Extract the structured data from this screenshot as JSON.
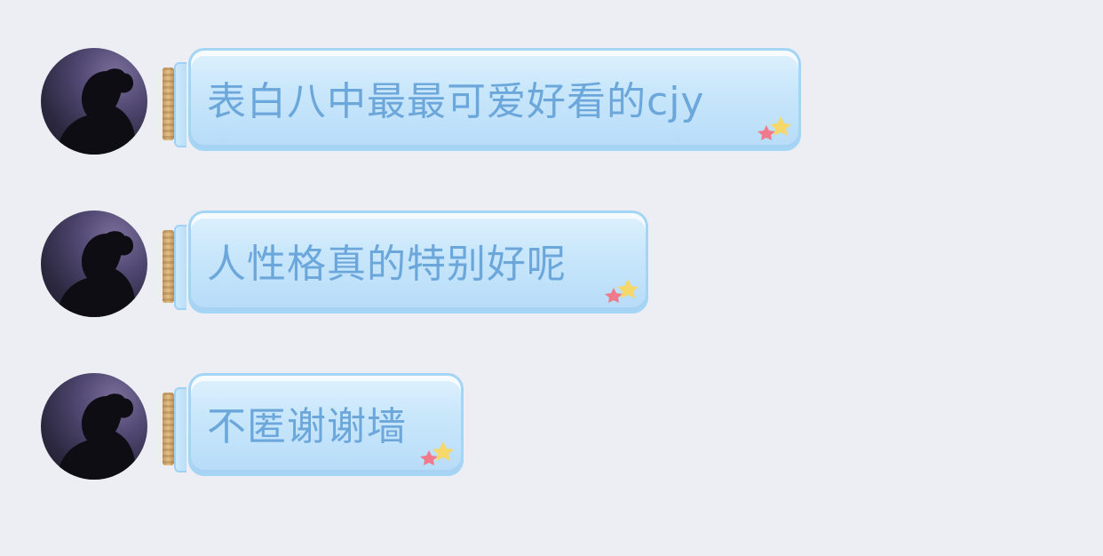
{
  "messages": [
    {
      "text": "表白八中最最可爱好看的cjy"
    },
    {
      "text": "人性格真的特别好呢"
    },
    {
      "text": "不匿谢谢墙"
    }
  ],
  "colors": {
    "background": "#edeef4",
    "bubble_text": "#6ca7dc",
    "bubble_border": "#a5d5f5"
  },
  "icons": {
    "avatar": "silhouette-avatar",
    "decoration": "star-icon"
  }
}
